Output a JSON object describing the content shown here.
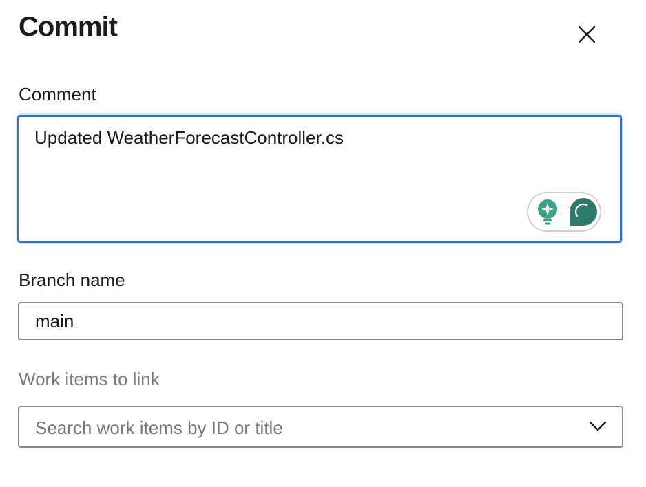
{
  "dialog": {
    "title": "Commit",
    "close_icon": "close-icon"
  },
  "comment": {
    "label": "Comment",
    "value": "Updated WeatherForecastController.cs",
    "assist_icons": [
      "lightbulb-sparkle-icon",
      "chat-assistant-icon"
    ],
    "accent_color": "#2f6fce",
    "icon_color": "#3aa387"
  },
  "branch": {
    "label": "Branch name",
    "value": "main"
  },
  "work_items": {
    "label": "Work items to link",
    "placeholder": "Search work items by ID or title",
    "dropdown_icon": "chevron-down-icon"
  }
}
